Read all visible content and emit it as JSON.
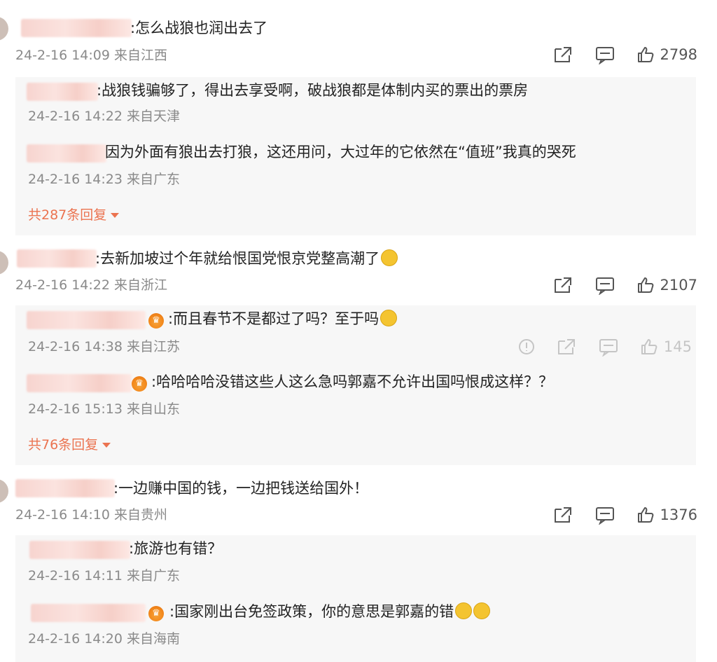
{
  "threads": [
    {
      "text": ":怎么战狼也润出去了",
      "meta": "24-2-16 14:09 来自江西",
      "likes": "2798",
      "replies": [
        {
          "text": ":战狼钱骗够了，得出去享受啊，破战狼都是体制内买的票出的票房",
          "meta": "24-2-16 14:22 来自天津"
        },
        {
          "text": "因为外面有狼出去打狼，这还用问，大过年的它依然在“值班”我真的哭死",
          "meta": "24-2-16 14:23 来自广东"
        }
      ],
      "more_replies": "共287条回复"
    },
    {
      "text": ":去新加坡过个年就给恨国党恨京党整高潮了",
      "meta": "24-2-16 14:22 来自浙江",
      "likes": "2107",
      "replies": [
        {
          "text": ":而且春节不是都过了吗？至于吗",
          "meta": "24-2-16 14:38 来自江苏",
          "likes": "145"
        },
        {
          "text": ":哈哈哈哈没错这些人这么急吗郭嘉不允许出国吗恨成这样？？",
          "meta": "24-2-16 15:13 来自山东"
        }
      ],
      "more_replies": "共76条回复"
    },
    {
      "text": ":一边赚中国的钱，一边把钱送给国外！",
      "meta": "24-2-16 14:10 来自贵州",
      "likes": "1376",
      "replies": [
        {
          "text": ":旅游也有错？",
          "meta": "24-2-16 14:11 来自广东"
        },
        {
          "text": ":国家刚出台免签政策，你的意思是郭嘉的错",
          "meta": "24-2-16 14:20 来自海南"
        }
      ]
    }
  ],
  "icons": [
    "share-icon",
    "comment-icon",
    "like-icon",
    "report-icon"
  ],
  "colors": {
    "more_link": "#eb7350",
    "meta": "#8a8a8a",
    "reply_bg": "#f7f7f7"
  }
}
